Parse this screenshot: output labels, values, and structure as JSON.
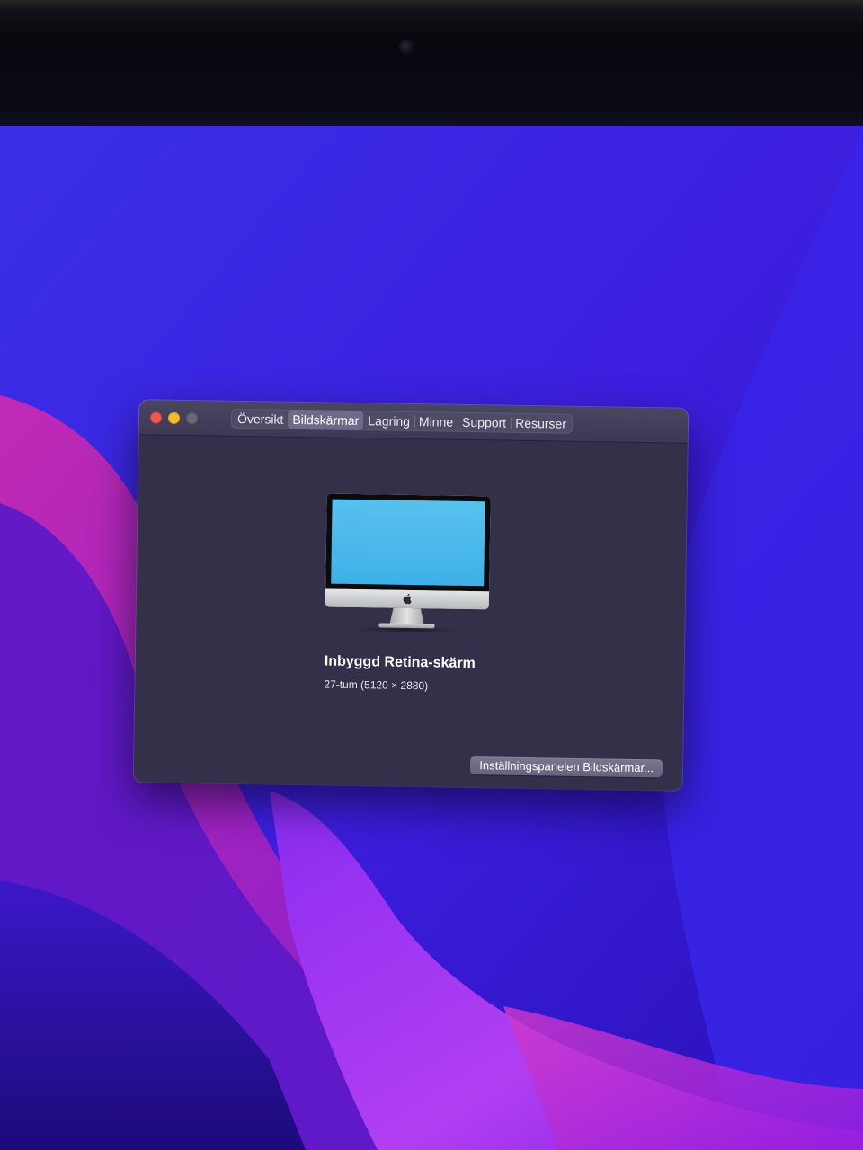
{
  "window": {
    "tabs": [
      {
        "label": "Översikt"
      },
      {
        "label": "Bildskärmar"
      },
      {
        "label": "Lagring"
      },
      {
        "label": "Minne"
      },
      {
        "label": "Support"
      },
      {
        "label": "Resurser"
      }
    ],
    "active_tab": "Bildskärmar",
    "display": {
      "name": "Inbyggd Retina-skärm",
      "size": "27-tum (5120 × 2880)"
    },
    "prefs_button_label": "Inställningspanelen Bildskärmar..."
  },
  "icons": {
    "display_image": "imac-icon",
    "logo": "apple-logo-icon"
  },
  "colors": {
    "close": "#ee5a4f",
    "minimize": "#f5bd2e",
    "zoom_disabled": "#6a6778",
    "window_bg": "#34304a",
    "screen": "#4fbbee"
  }
}
